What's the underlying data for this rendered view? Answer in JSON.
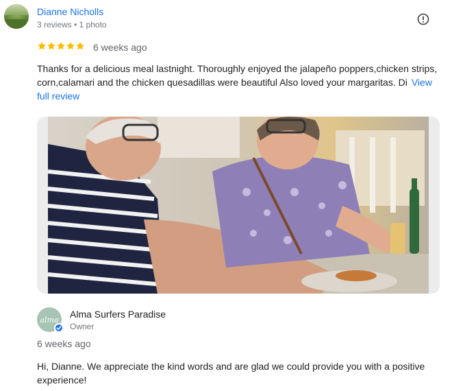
{
  "review": {
    "reviewer_name": "Dianne Nicholls",
    "reviewer_meta": "3 reviews • 1 photo",
    "rating": 5,
    "age": "6 weeks ago",
    "text": "Thanks for a delicious meal lastnight. Thoroughly enjoyed the jalapeño poppers,chicken strips, corn,calamari and the chicken quesadillas were beautiful Also loved your margaritas. Di",
    "view_full_label": "View full review"
  },
  "owner_response": {
    "name": "Alma Surfers Paradise",
    "role": "Owner",
    "avatar_text": "alma",
    "age": "6 weeks ago",
    "text": "Hi, Dianne. We appreciate the kind words and are glad we could provide you with a positive experience!"
  },
  "colors": {
    "link": "#1a73e8",
    "star": "#fbbc04",
    "muted": "#70757a"
  },
  "icons": {
    "report": "report-icon",
    "verified": "verified-check-icon",
    "star": "star-icon"
  }
}
